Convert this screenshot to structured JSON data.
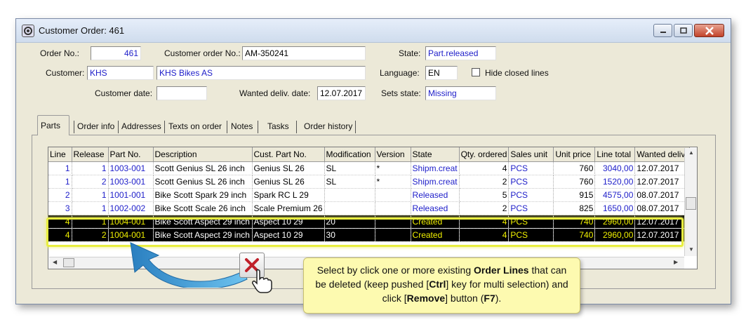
{
  "window": {
    "title": "Customer Order: 461"
  },
  "form": {
    "order_no_label": "Order No.:",
    "order_no_value": "461",
    "customer_order_no_label": "Customer order No.:",
    "customer_order_no_value": "AM-350241",
    "state_label": "State:",
    "state_value": "Part.released",
    "customer_label": "Customer:",
    "customer_code": "KHS",
    "customer_name": "KHS Bikes AS",
    "language_label": "Language:",
    "language_value": "EN",
    "hide_closed_label": "Hide closed lines",
    "customer_date_label": "Customer date:",
    "customer_date_value": "",
    "wanted_deliv_label": "Wanted deliv. date:",
    "wanted_deliv_value": "12.07.2017",
    "sets_state_label": "Sets state:",
    "sets_state_value": "Missing"
  },
  "tabs": [
    "Parts",
    "Order info",
    "Addresses",
    "Texts on order",
    "Notes",
    "Tasks",
    "Order history"
  ],
  "grid": {
    "columns": [
      "Line",
      "Release",
      "Part No.",
      "Description",
      "Cust. Part No.",
      "Modification",
      "Version",
      "State",
      "Qty. ordered",
      "Sales unit",
      "Unit price",
      "Line total",
      "Wanted deliv"
    ],
    "rows": [
      {
        "line": "1",
        "release": "1",
        "part_no": "1003-001",
        "description": "Scott Genius SL 26 inch",
        "cust_part_no": "Genius SL 26",
        "modification": "SL",
        "version": "*",
        "state": "Shipm.creat",
        "qty": "4",
        "unit": "PCS",
        "unit_price": "760",
        "line_total": "3040,00",
        "wanted": "12.07.2017",
        "selected": false
      },
      {
        "line": "1",
        "release": "2",
        "part_no": "1003-001",
        "description": "Scott Genius SL 26 inch",
        "cust_part_no": "Genius SL 26",
        "modification": "SL",
        "version": "*",
        "state": "Shipm.creat",
        "qty": "2",
        "unit": "PCS",
        "unit_price": "760",
        "line_total": "1520,00",
        "wanted": "12.07.2017",
        "selected": false
      },
      {
        "line": "2",
        "release": "1",
        "part_no": "1001-001",
        "description": "Bike Scott Spark 29 inch",
        "cust_part_no": "Spark RC L 29",
        "modification": "",
        "version": "",
        "state": "Released",
        "qty": "5",
        "unit": "PCS",
        "unit_price": "915",
        "line_total": "4575,00",
        "wanted": "08.07.2017",
        "selected": false
      },
      {
        "line": "3",
        "release": "1",
        "part_no": "1002-002",
        "description": "Bike Scott Scale 26 inch",
        "cust_part_no": "Scale Premium 26",
        "modification": "",
        "version": "",
        "state": "Released",
        "qty": "2",
        "unit": "PCS",
        "unit_price": "825",
        "line_total": "1650,00",
        "wanted": "08.07.2017",
        "selected": false
      },
      {
        "line": "4",
        "release": "1",
        "part_no": "1004-001",
        "description": "Bike Scott Aspect 29 inch",
        "cust_part_no": "Aspect 10 29",
        "modification": "20",
        "version": "",
        "state": "Created",
        "qty": "4",
        "unit": "PCS",
        "unit_price": "740",
        "line_total": "2960,00",
        "wanted": "12.07.2017",
        "selected": true
      },
      {
        "line": "4",
        "release": "2",
        "part_no": "1004-001",
        "description": "Bike Scott Aspect 29 inch",
        "cust_part_no": "Aspect 10 29",
        "modification": "30",
        "version": "",
        "state": "Created",
        "qty": "4",
        "unit": "PCS",
        "unit_price": "740",
        "line_total": "2960,00",
        "wanted": "12.07.2017",
        "selected": true
      }
    ]
  },
  "callout": {
    "t1": "Select by click one or more existing ",
    "t2": "Order Lines",
    "t3": " that can be deleted (keep pushed [",
    "t4": "Ctrl",
    "t5": "] key for multi selection) and click [",
    "t6": "Remove",
    "t7": "] button (",
    "t8": "F7",
    "t9": ")."
  },
  "colors": {
    "highlight": "#e8ee40",
    "arrow": "#3aa0d8",
    "remove_x": "#c0202a",
    "link_blue": "#1d1dc9",
    "selected_row_bg": "#000000",
    "selected_row_fg": "#f0f000"
  },
  "icons": [
    "app-icon",
    "minimize-icon",
    "maximize-icon",
    "close-icon",
    "remove-x-icon",
    "hand-cursor-icon",
    "curved-arrow-icon",
    "scroll-up-icon",
    "scroll-down-icon",
    "scroll-left-icon",
    "scroll-right-icon"
  ]
}
